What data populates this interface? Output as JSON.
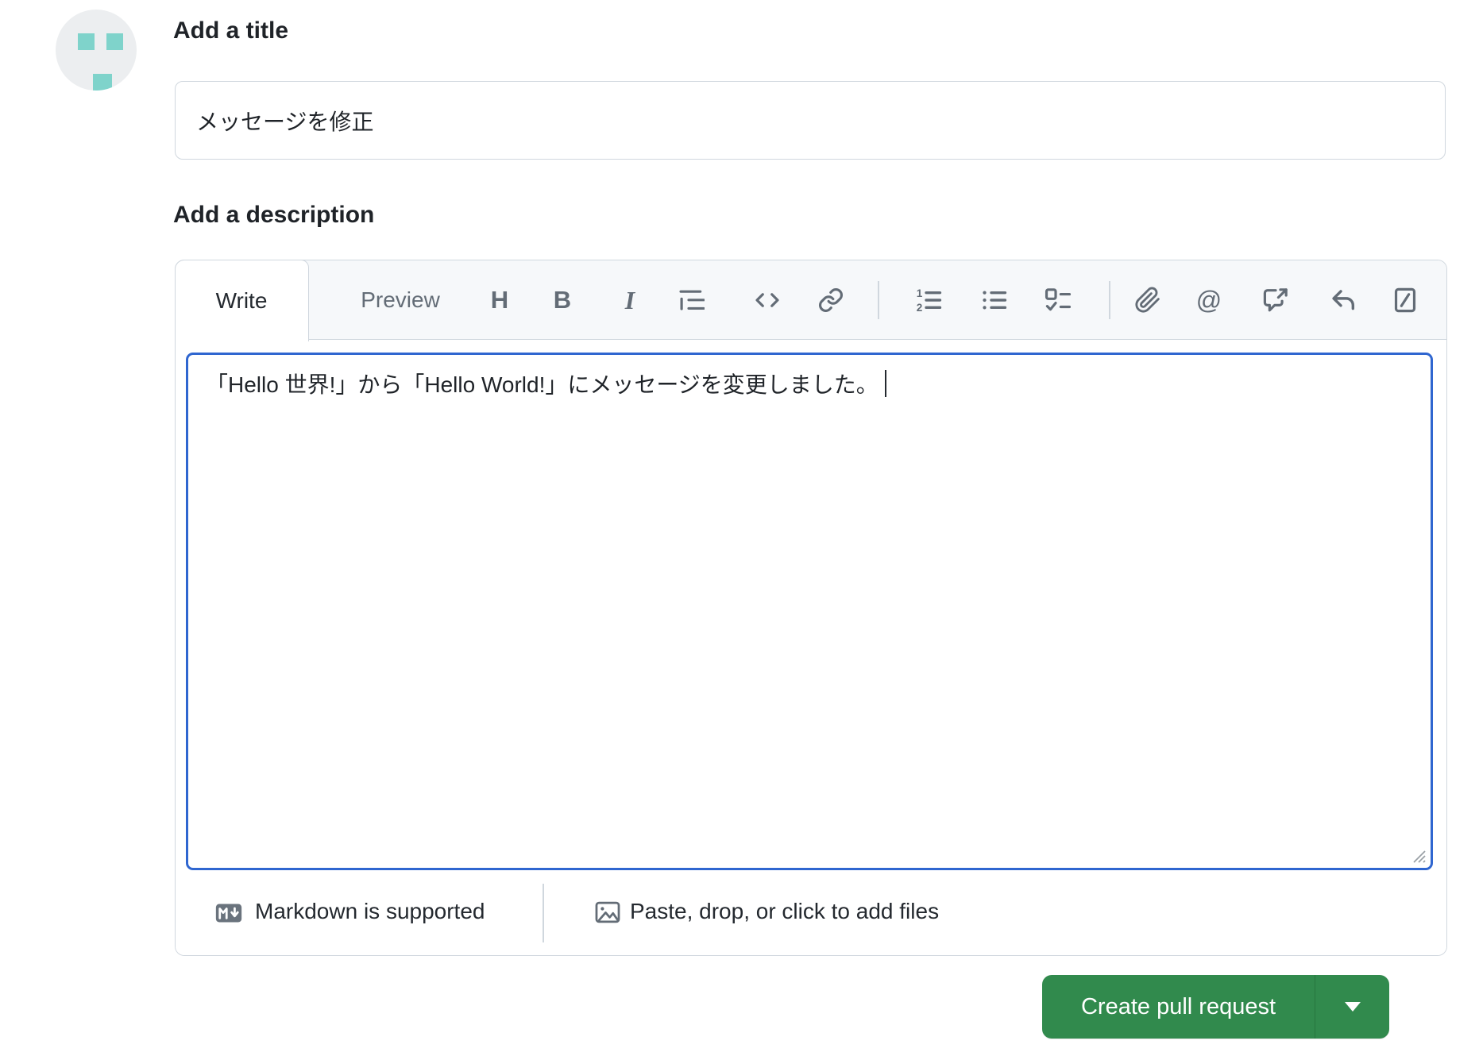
{
  "header": {
    "title_label": "Add a title",
    "title_value": "メッセージを修正"
  },
  "description": {
    "label": "Add a description",
    "tabs": {
      "write": "Write",
      "preview": "Preview"
    },
    "toolbar_glyphs": {
      "heading": "H",
      "bold": "B",
      "italic": "I",
      "mention": "@"
    },
    "toolbar_icons": [
      "heading-icon",
      "bold-icon",
      "italic-icon",
      "quote-icon",
      "code-icon",
      "link-icon",
      "numbered-list-icon",
      "bullet-list-icon",
      "task-list-icon",
      "attach-file-icon",
      "mention-icon",
      "cross-reference-icon",
      "saved-reply-icon",
      "slash-commands-icon"
    ],
    "body_text": "「Hello 世界!」から「Hello World!」にメッセージを変更しました。",
    "footer": {
      "markdown_note": "Markdown is supported",
      "attach_note": "Paste, drop, or click to add files"
    }
  },
  "actions": {
    "create_pull_request": "Create pull request"
  },
  "colors": {
    "button_green": "#318a4d",
    "focus_border_blue": "#2f66d0",
    "identicon_teal": "#7fd3cb",
    "toolbar_icon_gray": "#636c76",
    "border_gray": "#d0d7de",
    "tab_bar_bg": "#f6f8fa"
  }
}
